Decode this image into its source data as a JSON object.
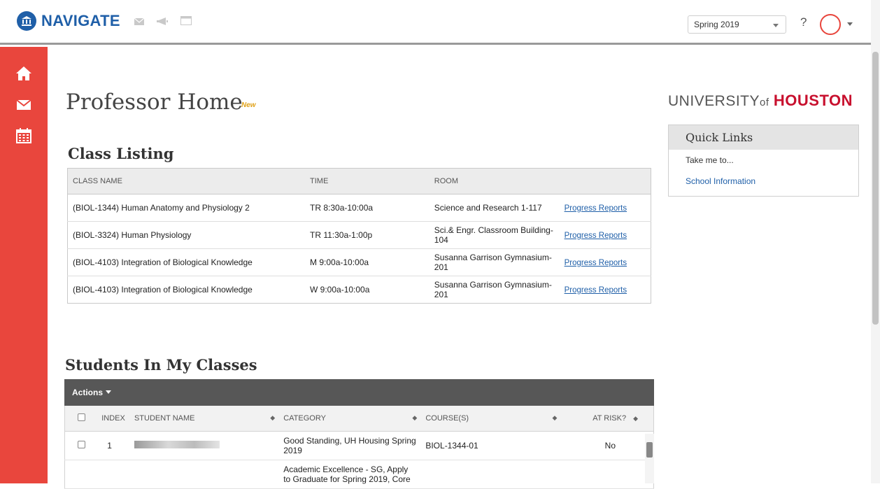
{
  "header": {
    "brand": "NAVIGATE",
    "term": "Spring 2019",
    "help": "?"
  },
  "colors": {
    "accent": "#e9463d",
    "brand": "#1f5fa8",
    "university_red": "#c8102e"
  },
  "sidebar": {
    "items": [
      {
        "icon": "home-icon"
      },
      {
        "icon": "mail-icon"
      },
      {
        "icon": "calendar-icon"
      }
    ]
  },
  "page": {
    "title": "Professor Home",
    "badge": "New"
  },
  "class_listing": {
    "heading": "Class Listing",
    "columns": [
      "CLASS NAME",
      "TIME",
      "ROOM"
    ],
    "rows": [
      {
        "name": "(BIOL-1344) Human Anatomy and Physiology 2",
        "time": "TR 8:30a-10:00a",
        "room": "Science and Research 1-117",
        "link": "Progress Reports"
      },
      {
        "name": "(BIOL-3324) Human Physiology",
        "time": "TR 11:30a-1:00p",
        "room": "Sci.& Engr. Classroom Building-104",
        "link": "Progress Reports"
      },
      {
        "name": "(BIOL-4103) Integration of Biological Knowledge",
        "time": "M 9:00a-10:00a",
        "room": "Susanna Garrison Gymnasium-201",
        "link": "Progress Reports"
      },
      {
        "name": "(BIOL-4103) Integration of Biological Knowledge",
        "time": "W 9:00a-10:00a",
        "room": "Susanna Garrison Gymnasium-201",
        "link": "Progress Reports"
      }
    ]
  },
  "students": {
    "heading": "Students In My Classes",
    "actions": "Actions",
    "columns": {
      "index": "INDEX",
      "name": "STUDENT NAME",
      "category": "CATEGORY",
      "courses": "COURSE(S)",
      "at_risk": "AT RISK?"
    },
    "rows": [
      {
        "index": "1",
        "category": "Good Standing, UH Housing Spring 2019",
        "courses": "BIOL-1344-01",
        "at_risk": "No"
      },
      {
        "index": "",
        "category": "Academic Excellence - SG, Apply to Graduate for Spring 2019, Core",
        "courses": "",
        "at_risk": ""
      }
    ]
  },
  "university": {
    "prefix": "UNIVERSITY",
    "of": "of",
    "name": "HOUSTON"
  },
  "quick_links": {
    "heading": "Quick Links",
    "items": [
      "Take me to...",
      "School Information"
    ]
  }
}
